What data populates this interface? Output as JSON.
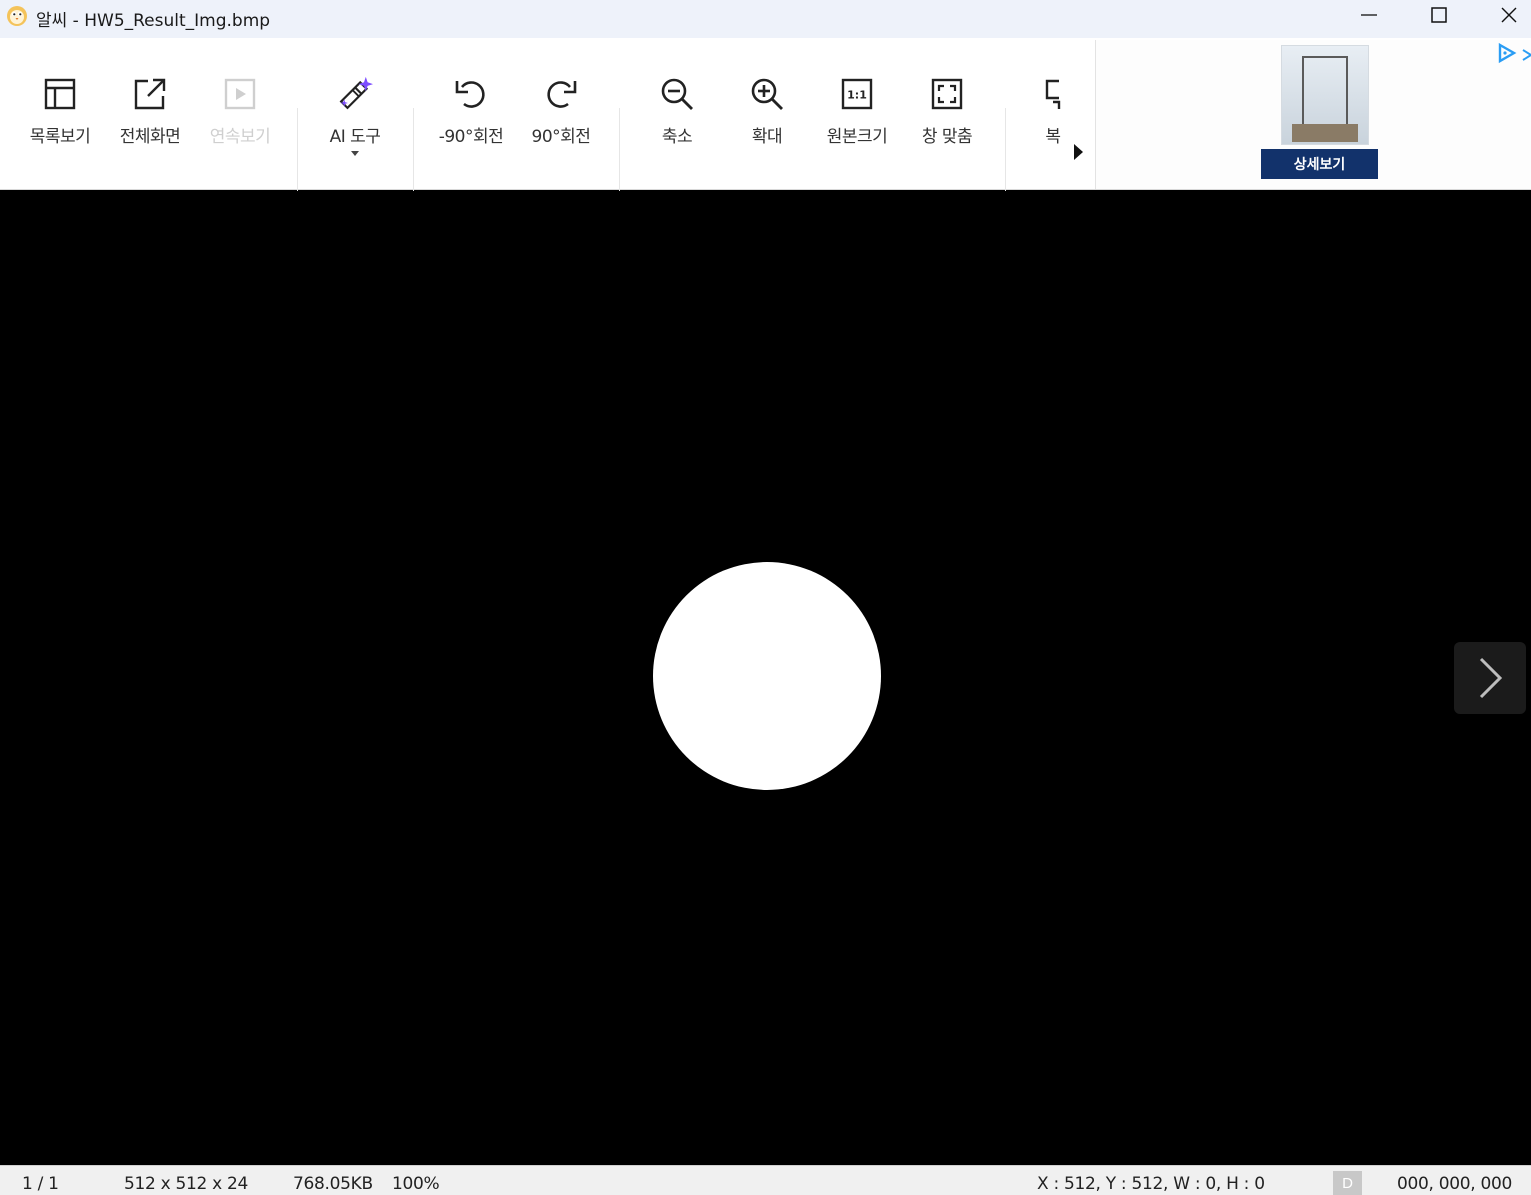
{
  "window": {
    "title": "알씨 - HW5_Result_Img.bmp",
    "controls": {
      "minimize": "minimize",
      "maximize": "maximize",
      "close": "close"
    }
  },
  "toolbar": {
    "items": [
      {
        "label": "목록보기",
        "icon": "list-view-icon",
        "enabled": true
      },
      {
        "label": "전체화면",
        "icon": "fullscreen-icon",
        "enabled": true
      },
      {
        "label": "연속보기",
        "icon": "slideshow-icon",
        "enabled": false
      },
      {
        "label": "AI 도구",
        "icon": "ai-magic-wand-icon",
        "enabled": true,
        "has_dropdown": true
      },
      {
        "label": "-90°회전",
        "icon": "rotate-left-icon",
        "enabled": true
      },
      {
        "label": "90°회전",
        "icon": "rotate-right-icon",
        "enabled": true
      },
      {
        "label": "축소",
        "icon": "zoom-out-icon",
        "enabled": true
      },
      {
        "label": "확대",
        "icon": "zoom-in-icon",
        "enabled": true
      },
      {
        "label": "원본크기",
        "icon": "original-size-icon",
        "enabled": true,
        "icon_text": "1:1"
      },
      {
        "label": "창 맞춤",
        "icon": "fit-window-icon",
        "enabled": true
      },
      {
        "label": "복",
        "icon": "copy-icon",
        "enabled": true
      }
    ],
    "overflow_icon": "more-arrow-icon"
  },
  "ad": {
    "button_label": "상세보기",
    "button_color": "#12326b",
    "choices_icon": "adchoices-icon",
    "close_icon": "close-icon"
  },
  "viewer": {
    "background": "#000000",
    "next_icon": "chevron-right-icon"
  },
  "statusbar": {
    "page": "1 / 1",
    "dimensions": "512 x 512 x 24",
    "file_size": "768.05KB",
    "zoom": "100%",
    "cursor": "X : 512, Y : 512, W : 0, H : 0",
    "badge": "D",
    "color_value": "000, 000, 000"
  },
  "colors": {
    "accent_purple": "#7c4dff",
    "ad_blue_icon": "#2a9df4"
  }
}
